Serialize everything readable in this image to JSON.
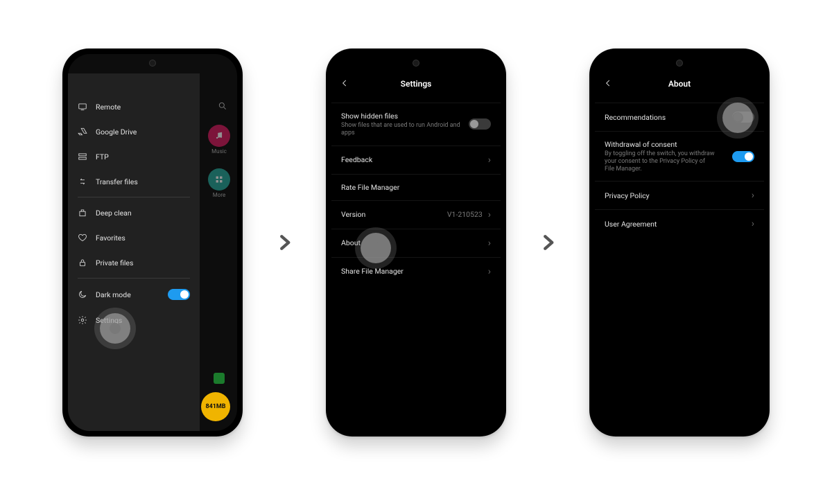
{
  "phone1": {
    "drawer": {
      "items": [
        {
          "icon": "remote-icon",
          "label": "Remote"
        },
        {
          "icon": "gdrive-icon",
          "label": "Google Drive"
        },
        {
          "icon": "ftp-icon",
          "label": "FTP"
        },
        {
          "icon": "transfer-icon",
          "label": "Transfer files"
        },
        {
          "icon": "cleaner-icon",
          "label": "Deep clean"
        },
        {
          "icon": "heart-icon",
          "label": "Favorites"
        },
        {
          "icon": "lock-icon",
          "label": "Private files"
        },
        {
          "icon": "moon-icon",
          "label": "Dark mode"
        },
        {
          "icon": "gear-icon",
          "label": "Settings"
        }
      ],
      "dark_mode_on": true
    },
    "bg_apps": [
      {
        "label": "Music",
        "color": "#d81b60"
      },
      {
        "label": "More",
        "color": "#26a69a"
      }
    ],
    "storage_badge": "841MB"
  },
  "phone2": {
    "title": "Settings",
    "rows": {
      "hidden_title": "Show hidden files",
      "hidden_sub": "Show files that are used to run Android and apps",
      "hidden_on": false,
      "feedback": "Feedback",
      "rate": "Rate File Manager",
      "version_label": "Version",
      "version_value": "V1-210523",
      "about": "About",
      "share": "Share File Manager"
    }
  },
  "phone3": {
    "title": "About",
    "rows": {
      "recommendations": "Recommendations",
      "recommendations_on": false,
      "withdraw_title": "Withdrawal of consent",
      "withdraw_sub": "By toggling off the switch, you withdraw your consent to the Privacy Policy of File Manager.",
      "withdraw_on": true,
      "privacy": "Privacy Policy",
      "agreement": "User Agreement"
    }
  }
}
